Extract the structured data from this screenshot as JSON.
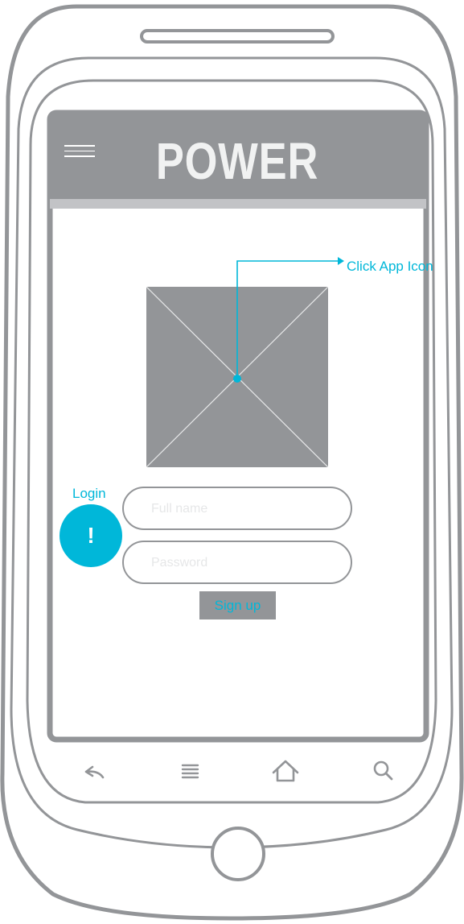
{
  "app_bar": {
    "title": "POWER",
    "menu_icon": "hamburger-icon"
  },
  "content": {
    "app_icon": "image-placeholder-icon",
    "click_annotation": "Click App Icon",
    "login_annotation": "Login",
    "alert_badge": "!",
    "fullname": {
      "placeholder": "Full name",
      "value": ""
    },
    "password": {
      "placeholder": "Password",
      "value": ""
    },
    "signup_label": "Sign up"
  },
  "nav_bar": {
    "icons": [
      "back-icon",
      "menu-list-icon",
      "home-icon",
      "search-icon"
    ]
  },
  "colors": {
    "gray": "#939598",
    "accent": "#00b7d9",
    "stripe": "#c2c3c6"
  }
}
